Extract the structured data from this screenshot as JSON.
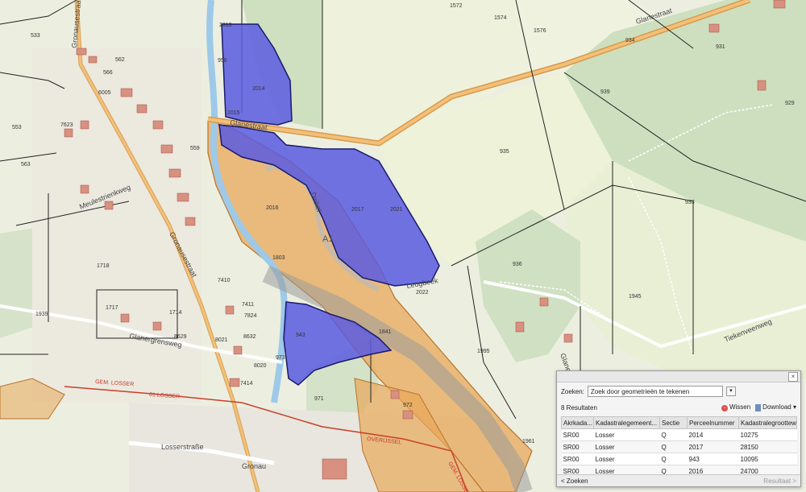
{
  "map": {
    "roads": {
      "glanestraat_upper": "Glanestraat",
      "glanestraat_left": "Glanestraat",
      "gronausestraat": "Gronausestraat",
      "gronausestraat_low": "Gronausestraat",
      "meulestrienkweg": "Meulestrienkweg",
      "glanergrensweg": "Glanergrensweg",
      "tiekenveenweg": "Tiekenveenweg",
      "losserstrasse": "Losserstraße",
      "gronau": "Gronau",
      "a1": "A1",
      "dinkel": "Dinkel",
      "glane": "Glane",
      "leugbeek": "Leugbeek"
    },
    "boundary_labels": {
      "gem_losser": "GEM. LOSSER",
      "gem_losser_2": "GEM. LOSSER",
      "s1_losser": "01 LOSSER",
      "overijssel": "OVERIJSSEL"
    },
    "parcels": {
      "p2014": "2014",
      "p2015": "2015",
      "p2016": "2016",
      "p2017": "2017",
      "p943": "943",
      "p1841": "1841",
      "p972": "972",
      "p971": "971",
      "p1995": "1995",
      "p1945": "1945",
      "p936": "936",
      "p935": "935",
      "p933": "933",
      "p939": "939",
      "p934": "934",
      "p931": "931",
      "p1572": "1572",
      "p1574": "1574",
      "p1576": "1576",
      "p929": "929",
      "p553": "553",
      "p533": "533",
      "p563": "563",
      "p562": "562",
      "p566": "566",
      "p1718": "1718",
      "p1939": "1939",
      "p1717": "1717",
      "p1714": "1714",
      "p7410": "7410",
      "p7411": "7411",
      "p7824": "7824",
      "p8632": "8632",
      "p8021": "8021",
      "p8020": "8020",
      "p7414": "7414",
      "p7623": "7623",
      "p6005": "6005",
      "p559": "559",
      "p2022": "2022",
      "p2021": "2021",
      "p2013": "2013",
      "p956": "956",
      "p1803": "1803",
      "p8629": "8629",
      "p973": "973",
      "p1961": "1961"
    }
  },
  "panel": {
    "search_label": "Zoeken:",
    "search_option": "Zoek door geometrieën te tekenen",
    "close": "×",
    "results_count": "8 Resultaten",
    "wissen": "Wissen",
    "download": "Download",
    "columns": [
      "Akrkada...",
      "Kadastralegemeent...",
      "Sectie",
      "Perceelnummer",
      "Kadastralegrootteware"
    ],
    "rows": [
      [
        "SR00",
        "Losser",
        "Q",
        "2014",
        "10275"
      ],
      [
        "SR00",
        "Losser",
        "Q",
        "2017",
        "28150"
      ],
      [
        "SR00",
        "Losser",
        "Q",
        "943",
        "10095"
      ],
      [
        "SR00",
        "Losser",
        "Q",
        "2016",
        "24700"
      ]
    ],
    "back": "< Zoeken",
    "next": "Resultaat >"
  },
  "colors": {
    "selected_parcel": "#5a5ae0",
    "highlight_parcel": "#e8a85a",
    "forest": "#cfe0c2",
    "meadow": "#eaf0d4",
    "water": "#9ec9e8",
    "boundary": "#c8402a"
  }
}
